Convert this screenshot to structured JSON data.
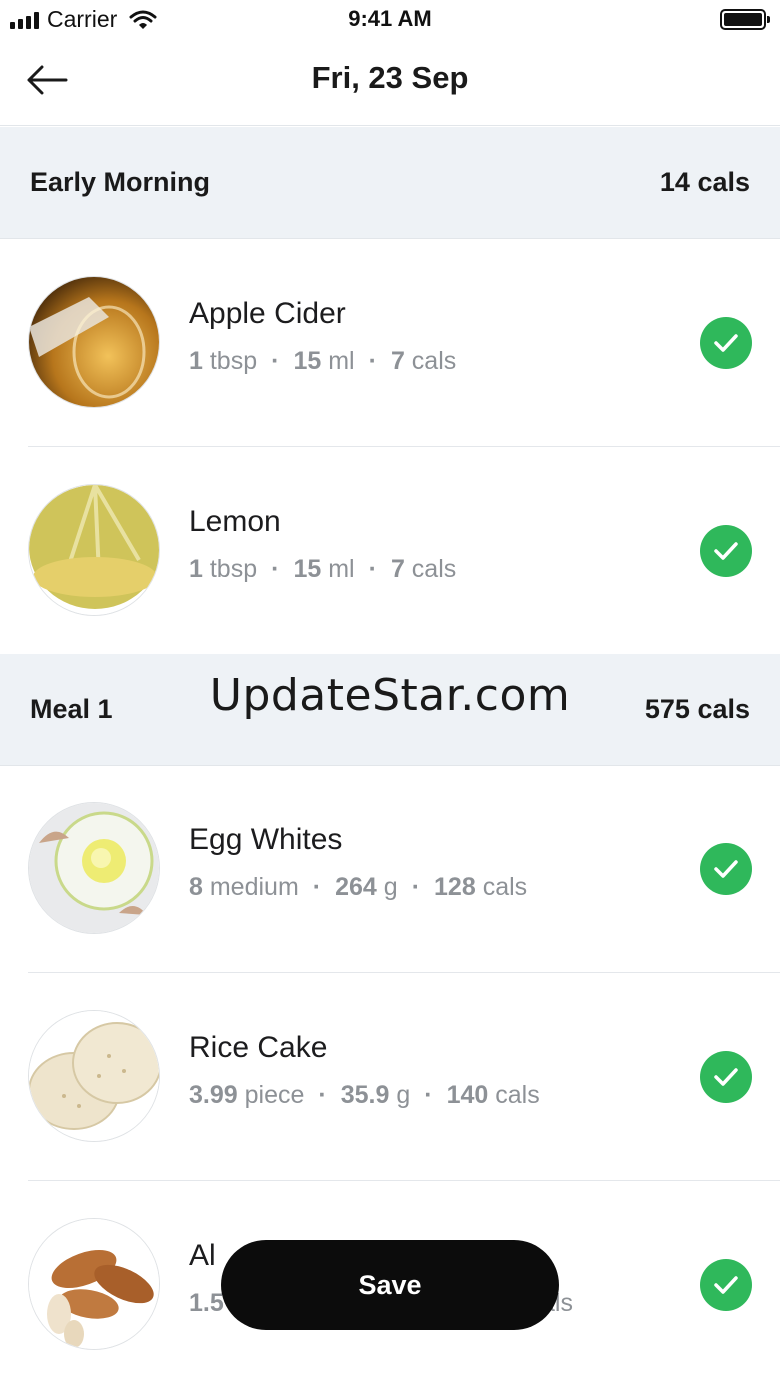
{
  "status_bar": {
    "carrier": "Carrier",
    "time": "9:41 AM"
  },
  "nav": {
    "title": "Fri, 23 Sep"
  },
  "sections": [
    {
      "title": "Early Morning",
      "cals": "14 cals",
      "items": [
        {
          "name": "Apple Cider",
          "qty_num": "1",
          "qty_unit": "tbsp",
          "weight_num": "15",
          "weight_unit": "ml",
          "cals_num": "7",
          "cals_unit": "cals",
          "checked": true
        },
        {
          "name": "Lemon",
          "qty_num": "1",
          "qty_unit": "tbsp",
          "weight_num": "15",
          "weight_unit": "ml",
          "cals_num": "7",
          "cals_unit": "cals",
          "checked": true
        }
      ]
    },
    {
      "title": "Meal 1",
      "cals": "575 cals",
      "items": [
        {
          "name": "Egg Whites",
          "qty_num": "8",
          "qty_unit": "medium",
          "weight_num": "264",
          "weight_unit": "g",
          "cals_num": "128",
          "cals_unit": "cals",
          "checked": true
        },
        {
          "name": "Rice Cake",
          "qty_num": "3.99",
          "qty_unit": "piece",
          "weight_num": "35.9",
          "weight_unit": "g",
          "cals_num": "140",
          "cals_unit": "cals",
          "checked": true
        },
        {
          "name": "Al",
          "qty_num": "1.5",
          "qty_unit": "",
          "weight_num": "",
          "weight_unit": "",
          "cals_num": "",
          "cals_unit": "als",
          "checked": true
        }
      ]
    }
  ],
  "watermark": "UpdateStar.com",
  "save_label": "Save",
  "colors": {
    "check": "#2fb85b",
    "section_bg": "#eef2f6",
    "save_bg": "#0c0c0c",
    "meta_text": "#8d9196"
  }
}
